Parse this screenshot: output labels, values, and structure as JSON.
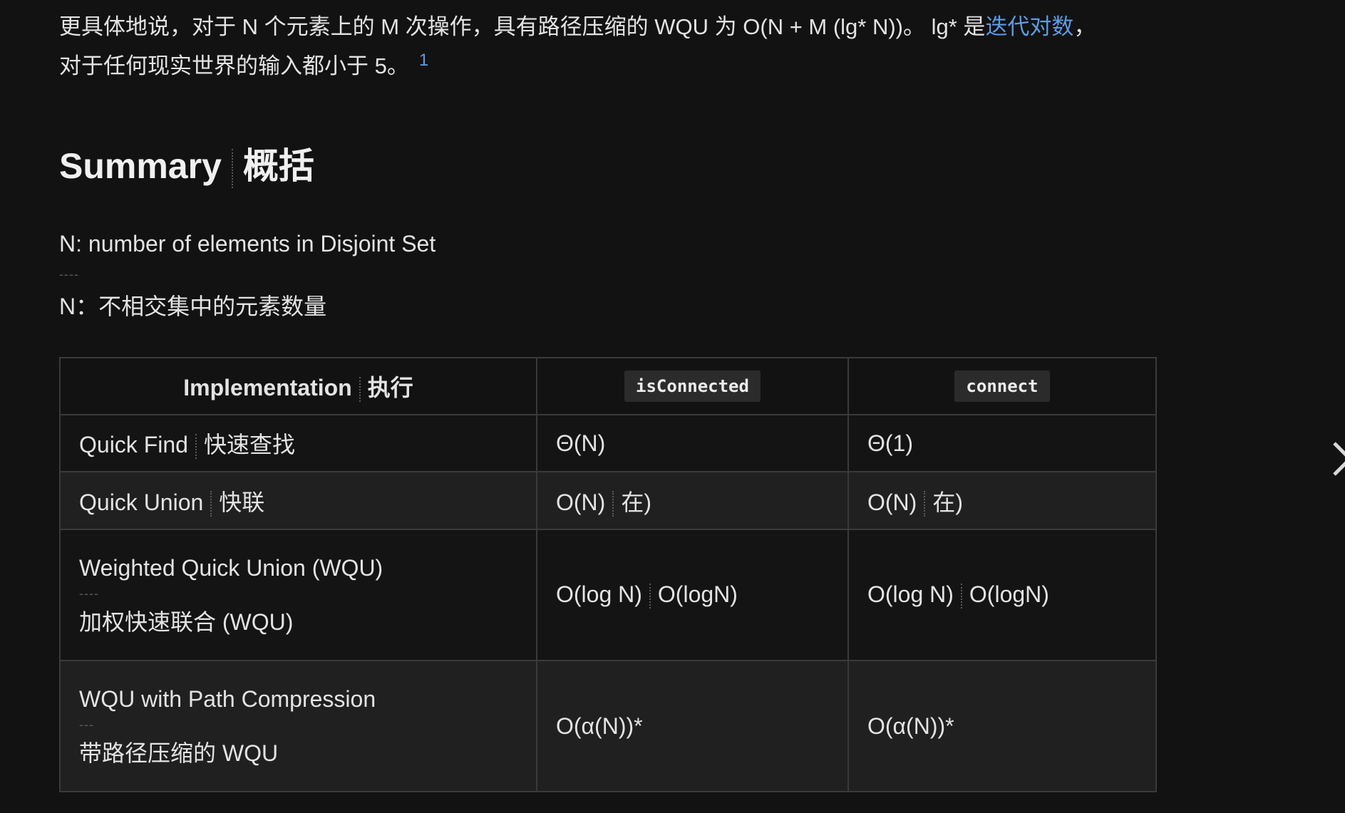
{
  "intro": {
    "text_before_link": "更具体地说，对于 N 个元素上的 M 次操作，具有路径压缩的 WQU 为 O(N + M (lg* N))。 lg* 是",
    "link_text": "迭代对数",
    "text_after_link": "，",
    "line2": "对于任何现实世界的输入都小于 5。",
    "footnote": "1"
  },
  "summary": {
    "heading_en": "Summary",
    "heading_zh": "概括",
    "def_en": "N: number of elements in Disjoint Set",
    "def_sep": "----",
    "def_zh": "N：不相交集中的元素数量"
  },
  "table": {
    "headers": {
      "impl_en": "Implementation",
      "impl_zh": "执行",
      "is_connected": "isConnected",
      "connect": "connect"
    },
    "rows": [
      {
        "impl_en": "Quick Find",
        "impl_zh": "快速查找",
        "is_connected": "Θ(N)",
        "connect": "Θ(1)"
      },
      {
        "impl_en": "Quick Union",
        "impl_zh": "快联",
        "is_connected_en": "O(N)",
        "is_connected_zh": "在)",
        "connect_en": "O(N)",
        "connect_zh": "在)"
      },
      {
        "impl_en": "Weighted Quick Union (WQU)",
        "impl_sep": "----",
        "impl_zh": "加权快速联合 (WQU)",
        "is_connected_en": "O(log N)",
        "is_connected_zh": "O(logN)",
        "connect_en": "O(log N)",
        "connect_zh": "O(logN)"
      },
      {
        "impl_en": "WQU with Path Compression",
        "impl_sep": "---",
        "impl_zh": "带路径压缩的 WQU",
        "is_connected": "O(α(N))*",
        "connect": "O(α(N))*"
      }
    ]
  },
  "nav": {
    "next_icon": "chevron-right-icon"
  }
}
